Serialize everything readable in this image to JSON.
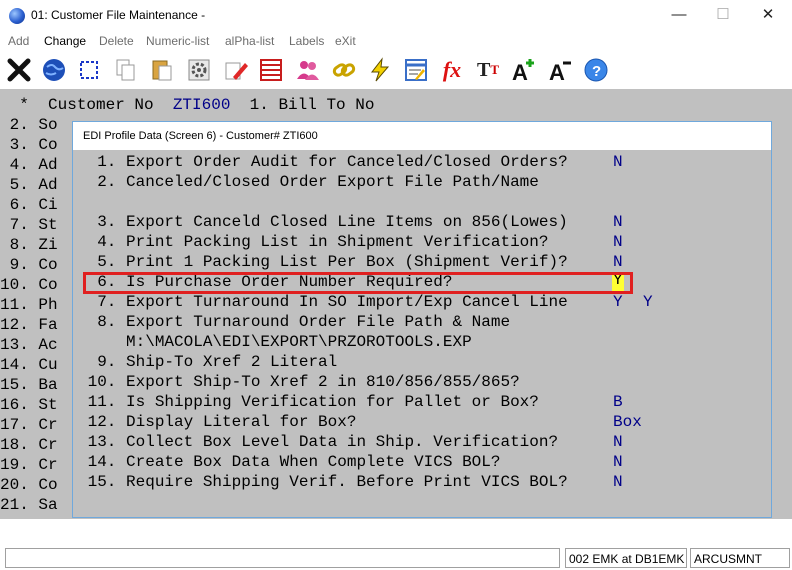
{
  "window": {
    "title": "01: Customer File Maintenance -",
    "minimize": "—",
    "maximize": "☐",
    "close": "✕"
  },
  "menu": {
    "items": [
      "Add",
      "Change",
      "Delete",
      "Numeric-list",
      "alPha-list",
      "Labels",
      "eXit"
    ]
  },
  "toolbar": {
    "icons": [
      "exit-x-icon",
      "globe-icon",
      "select-icon",
      "copy-icon",
      "paste-icon",
      "settings-gear-icon",
      "edit-eraser-icon",
      "table-icon",
      "users-icon",
      "chain-link-icon",
      "lightning-icon",
      "report-icon",
      "function-fx-icon",
      "text-size-icon",
      "font-increase-icon",
      "font-decrease-icon",
      "help-icon"
    ]
  },
  "terminal": {
    "header": "  *  Customer No  ",
    "header_id": "ZTI600",
    "header_field": "  1. Bill To No",
    "rows": [
      " 2. So",
      " 3. Co",
      " 4. Ad",
      " 5. Ad",
      " 6. Ci",
      " 7. St",
      " 8. Zi",
      " 9. Co",
      "10. Co",
      "11. Ph",
      "12. Fa",
      "13. Ac",
      "14. Cu",
      "15. Ba",
      "16. St",
      "17. Cr",
      "18. Cr",
      "19. Cr",
      "20. Co",
      "21. Sa"
    ]
  },
  "dialog": {
    "title": "EDI Profile Data (Screen 6) - Customer# ZTI600",
    "rows": [
      {
        "text": "  1. Export Order Audit for Canceled/Closed Orders?",
        "value": "N",
        "value2": ""
      },
      {
        "text": "  2. Canceled/Closed Order Export File Path/Name",
        "value": "",
        "value2": ""
      },
      {
        "text": "",
        "value": "",
        "value2": ""
      },
      {
        "text": "  3. Export Canceld Closed Line Items on 856(Lowes)",
        "value": "N",
        "value2": ""
      },
      {
        "text": "  4. Print Packing List in Shipment Verification?",
        "value": "N",
        "value2": ""
      },
      {
        "text": "  5. Print 1 Packing List Per Box (Shipment Verif)?",
        "value": "N",
        "value2": ""
      },
      {
        "text": "  6. Is Purchase Order Number Required?",
        "value": "Y",
        "value2": ""
      },
      {
        "text": "  7. Export Turnaround In SO Import/Exp Cancel Line",
        "value": "Y",
        "value2": "Y"
      },
      {
        "text": "  8. Export Turnaround Order File Path & Name",
        "value": "",
        "value2": ""
      },
      {
        "text": "     M:\\MACOLA\\EDI\\EXPORT\\PRZOROTOOLS.EXP",
        "value": "",
        "value2": ""
      },
      {
        "text": "  9. Ship-To Xref 2 Literal",
        "value": "",
        "value2": ""
      },
      {
        "text": " 10. Export Ship-To Xref 2 in 810/856/855/865?",
        "value": "",
        "value2": ""
      },
      {
        "text": " 11. Is Shipping Verification for Pallet or Box?",
        "value": "B",
        "value2": ""
      },
      {
        "text": " 12. Display Literal for Box?",
        "value": "Box",
        "value2": ""
      },
      {
        "text": " 13. Collect Box Level Data in Ship. Verification?",
        "value": "N",
        "value2": ""
      },
      {
        "text": " 14. Create Box Data When Complete VICS BOL?",
        "value": "N",
        "value2": ""
      },
      {
        "text": " 15. Require Shipping Verif. Before Print VICS BOL?",
        "value": "N",
        "value2": ""
      }
    ]
  },
  "status": {
    "field1": "",
    "session": "002 EMK at DB1EMK",
    "program": "ARCUSMNT"
  },
  "colors": {
    "terminal_bg": "#c0c0c0",
    "value_text": "#000088",
    "highlight_border": "#e02020",
    "edit_bg": "#ffff33"
  }
}
